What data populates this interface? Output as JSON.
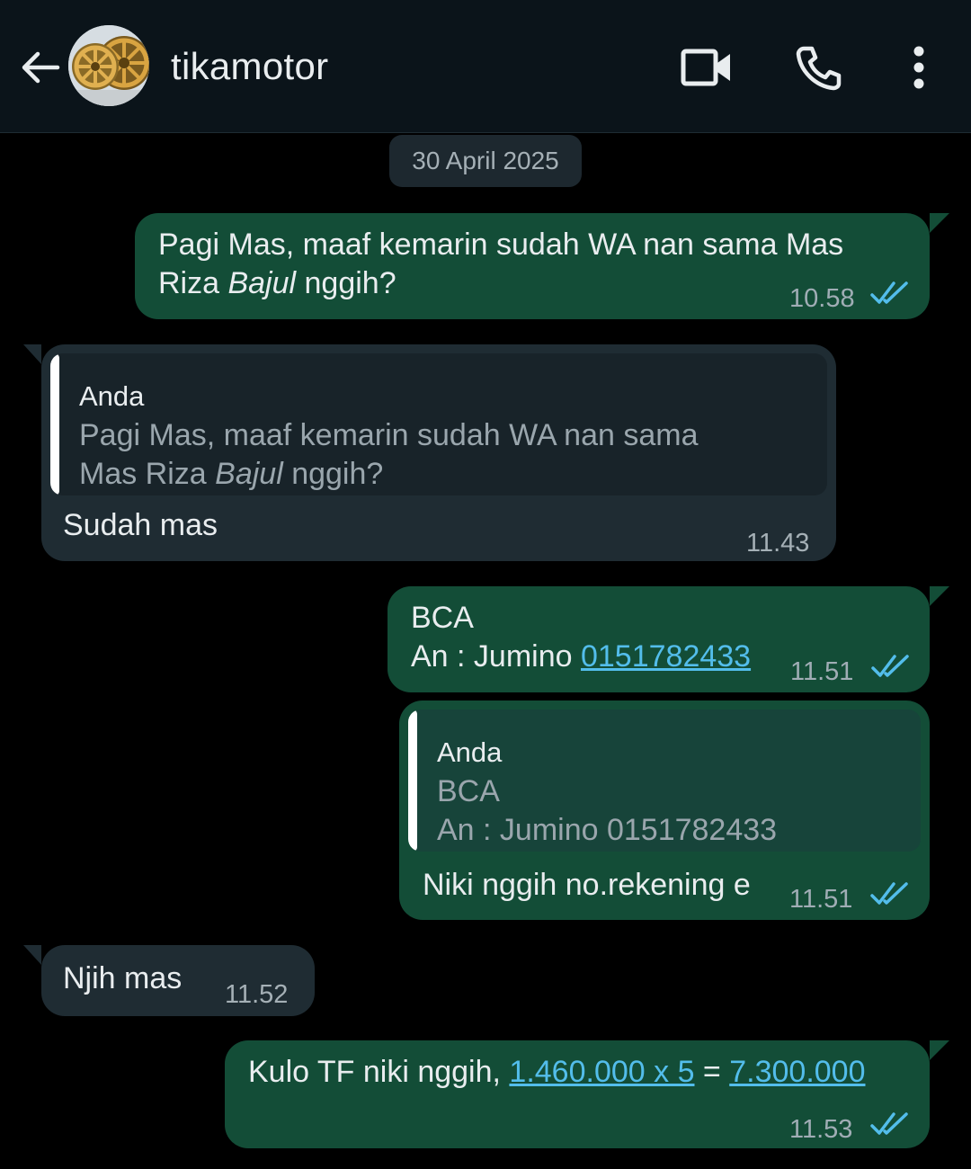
{
  "header": {
    "contact_name": "tikamotor",
    "back_icon": "arrow-left-icon",
    "video_icon": "video-call-icon",
    "call_icon": "phone-icon",
    "menu_icon": "more-vertical-icon"
  },
  "date_chip": "30 April 2025",
  "colors": {
    "outgoing_bubble": "#134d37",
    "incoming_bubble": "#1f2c33",
    "link": "#53bdeb",
    "read_ticks": "#53bdeb"
  },
  "messages": [
    {
      "direction": "outgoing",
      "line1": "Pagi Mas, maaf kemarin sudah WA nan sama Mas",
      "line2_a": "Riza ",
      "line2_b": "Bajul",
      "line2_c": " nggih?",
      "time": "10.58",
      "status": "read"
    },
    {
      "direction": "incoming",
      "quote_author": "Anda",
      "quote_line1": "Pagi Mas, maaf kemarin sudah WA nan sama",
      "quote_line2_a": "Mas Riza ",
      "quote_line2_b": "Bajul",
      "quote_line2_c": " nggih?",
      "text": "Sudah mas",
      "time": "11.43"
    },
    {
      "direction": "outgoing",
      "line1": "BCA",
      "line2": "An : Jumino ",
      "link": "0151782433",
      "time": "11.51",
      "status": "read"
    },
    {
      "direction": "outgoing",
      "quote_author": "Anda",
      "quote_line1": "BCA",
      "quote_line2": "An : Jumino 0151782433",
      "text": "Niki nggih no.rekening e",
      "time": "11.51",
      "status": "read"
    },
    {
      "direction": "incoming",
      "text": "Njih mas",
      "time": "11.52"
    },
    {
      "direction": "outgoing",
      "text": "Kulo TF niki nggih, ",
      "link1": "1.460.000 x 5",
      "eq": " = ",
      "link2": "7.300.000",
      "time": "11.53",
      "status": "read"
    }
  ]
}
